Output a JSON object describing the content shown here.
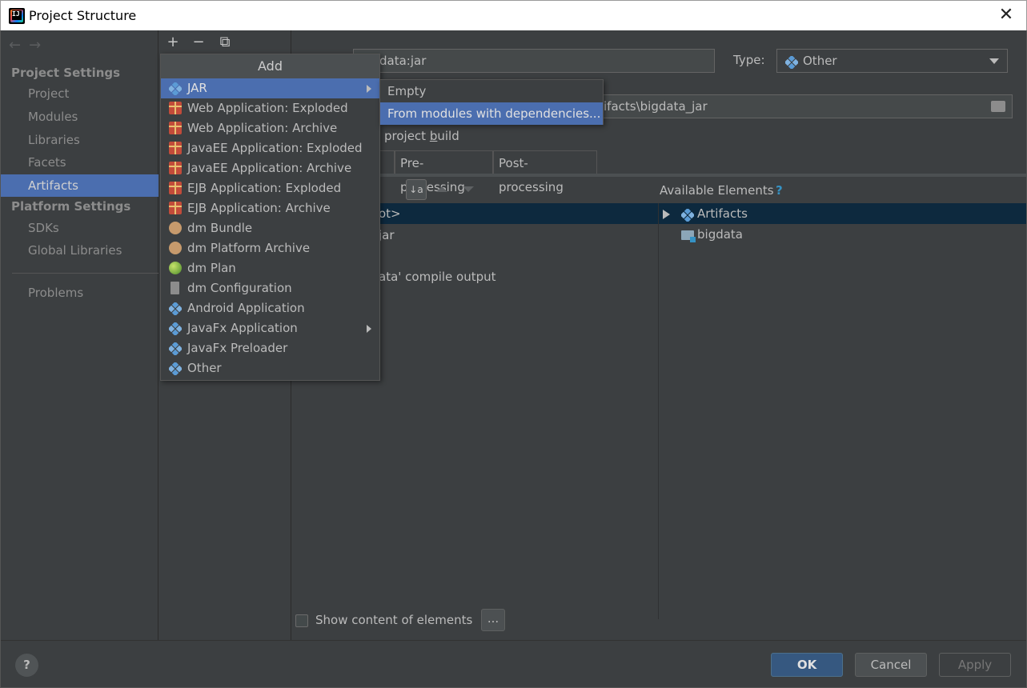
{
  "window": {
    "title": "Project Structure",
    "close_glyph": "✕"
  },
  "nav": {
    "back": "←",
    "forward": "→"
  },
  "sidebar": {
    "project_settings_header": "Project Settings",
    "project_items": [
      "Project",
      "Modules",
      "Libraries",
      "Facets",
      "Artifacts"
    ],
    "selected": "Artifacts",
    "platform_settings_header": "Platform Settings",
    "platform_items": [
      "SDKs",
      "Global Libraries"
    ],
    "problems": "Problems"
  },
  "middle_toolbar": {
    "add": "+",
    "remove": "−",
    "copy": "⧉"
  },
  "artifact": {
    "name_value": "data:jar",
    "type_label": "Type:",
    "type_value": "Other",
    "output_dir_value": "ifacts\\bigdata_jar",
    "include_build_prefix": "project ",
    "include_build_underlined": "b",
    "include_build_suffix": "uild"
  },
  "tabs": [
    "ut",
    "Pre-processing",
    "Post-processing"
  ],
  "layout_tree": {
    "root": "ot>",
    "jar": "jar",
    "compile_output": "ata' compile output",
    "sort_icon": "↓a z"
  },
  "available": {
    "label": "Available Elements",
    "help": "?",
    "nodes": [
      "Artifacts",
      "bigdata"
    ]
  },
  "show_content": {
    "label": "Show content of elements",
    "checked": false,
    "more_button": "..."
  },
  "buttons": {
    "help": "?",
    "ok": "OK",
    "cancel": "Cancel",
    "apply": "Apply"
  },
  "add_popup": {
    "title": "Add",
    "items": [
      {
        "label": "JAR",
        "icon": "diamond-icon",
        "submenu": true,
        "selected": true
      },
      {
        "label": "Web Application: Exploded",
        "icon": "gift-icon"
      },
      {
        "label": "Web Application: Archive",
        "icon": "gift-icon"
      },
      {
        "label": "JavaEE Application: Exploded",
        "icon": "gift-icon"
      },
      {
        "label": "JavaEE Application: Archive",
        "icon": "gift-icon"
      },
      {
        "label": "EJB Application: Exploded",
        "icon": "gift-icon"
      },
      {
        "label": "EJB Application: Archive",
        "icon": "gift-icon"
      },
      {
        "label": "dm Bundle",
        "icon": "gear-icon"
      },
      {
        "label": "dm Platform Archive",
        "icon": "gear-icon"
      },
      {
        "label": "dm Plan",
        "icon": "globe-icon"
      },
      {
        "label": "dm Configuration",
        "icon": "document-icon"
      },
      {
        "label": "Android Application",
        "icon": "diamond-icon"
      },
      {
        "label": "JavaFx Application",
        "icon": "diamond-icon",
        "submenu": true
      },
      {
        "label": "JavaFx Preloader",
        "icon": "diamond-icon"
      },
      {
        "label": "Other",
        "icon": "diamond-icon"
      }
    ]
  },
  "jar_submenu": {
    "items": [
      "Empty",
      "From modules with dependencies..."
    ],
    "selected": "From modules with dependencies..."
  },
  "colors": {
    "selection": "#4b6eaf",
    "panel": "#3c3f41",
    "tree_selection": "#0d293e",
    "ok_button": "#365880",
    "diamond_icon": "#5b9bd5"
  }
}
